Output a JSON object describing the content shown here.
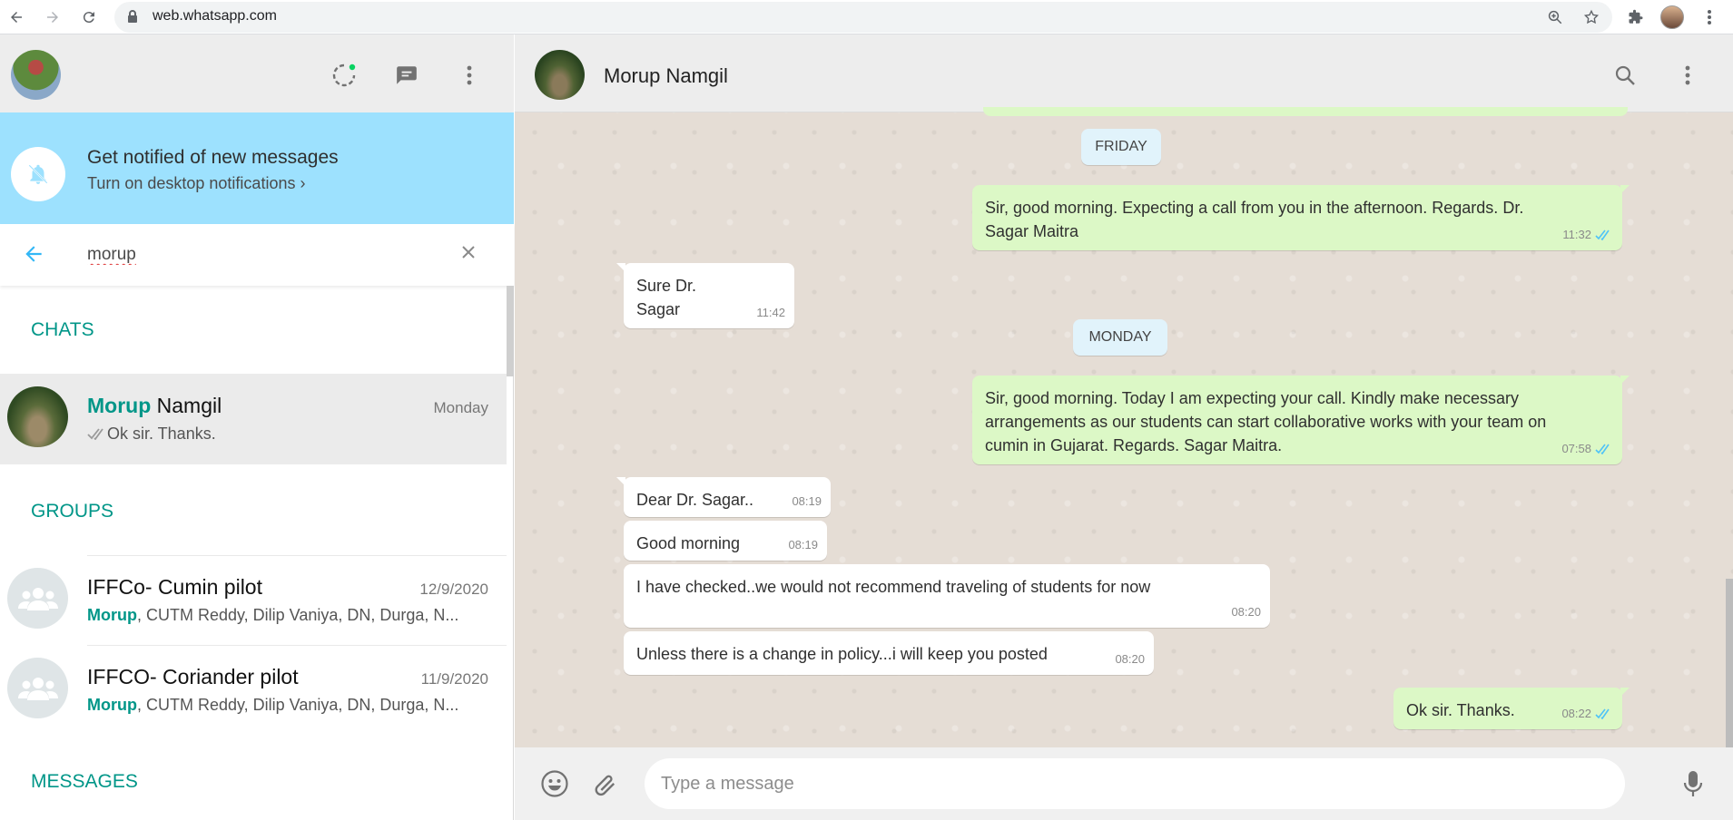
{
  "browser": {
    "url": "web.whatsapp.com"
  },
  "left": {
    "notification": {
      "title": "Get notified of new messages",
      "link": "Turn on desktop notifications ›"
    },
    "search": {
      "value": "morup"
    },
    "sections": {
      "chats": "CHATS",
      "groups": "GROUPS",
      "messages": "MESSAGES"
    },
    "chats": [
      {
        "name_match": "Morup",
        "name_rest": " Namgil",
        "time": "Monday",
        "preview": "Ok sir. Thanks."
      }
    ],
    "groups": [
      {
        "name": "IFFCo- Cumin pilot",
        "time": "12/9/2020",
        "preview_match": "Morup",
        "preview_rest": ", CUTM Reddy, Dilip Vaniya, DN, Durga, N..."
      },
      {
        "name": "IFFCO- Coriander pilot",
        "time": "11/9/2020",
        "preview_match": "Morup",
        "preview_rest": ", CUTM Reddy, Dilip Vaniya, DN, Durga, N..."
      }
    ]
  },
  "conversation": {
    "contact_name": "Morup Namgil",
    "days": {
      "friday": "FRIDAY",
      "monday": "MONDAY"
    },
    "messages": [
      {
        "dir": "out",
        "text": "Sir, good morning. Expecting a call from you in the afternoon. Regards. Dr. Sagar Maitra",
        "time": "11:32"
      },
      {
        "dir": "in",
        "text": "Sure Dr. Sagar",
        "time": "11:42"
      },
      {
        "dir": "out",
        "text": "Sir, good morning. Today I am expecting your call. Kindly make necessary arrangements as our students can start collaborative works with your team on cumin in Gujarat. Regards. Sagar Maitra.",
        "time": "07:58"
      },
      {
        "dir": "in",
        "text": "Dear Dr. Sagar..",
        "time": "08:19"
      },
      {
        "dir": "in",
        "text": "Good morning",
        "time": "08:19"
      },
      {
        "dir": "in",
        "text": "I have checked..we would not recommend traveling of students for now",
        "time": "08:20"
      },
      {
        "dir": "in",
        "text": "Unless there is a change in policy...i will keep you posted",
        "time": "08:20"
      },
      {
        "dir": "out",
        "text": "Ok sir. Thanks.",
        "time": "08:22"
      }
    ],
    "compose_placeholder": "Type a message"
  },
  "colors": {
    "accent": "#009688",
    "notify_bg": "#9de1fe",
    "outgoing_bubble": "#dcf8c6",
    "incoming_bubble": "#ffffff",
    "read_ticks": "#4fc3f7"
  },
  "icons": {
    "status": "status-icon",
    "new_chat": "new-chat-icon",
    "menu": "menu-icon",
    "bell_off": "bell-off-icon",
    "back": "back-arrow-icon",
    "clear": "close-icon",
    "search": "search-icon",
    "emoji": "emoji-icon",
    "attach": "paperclip-icon",
    "mic": "microphone-icon"
  }
}
